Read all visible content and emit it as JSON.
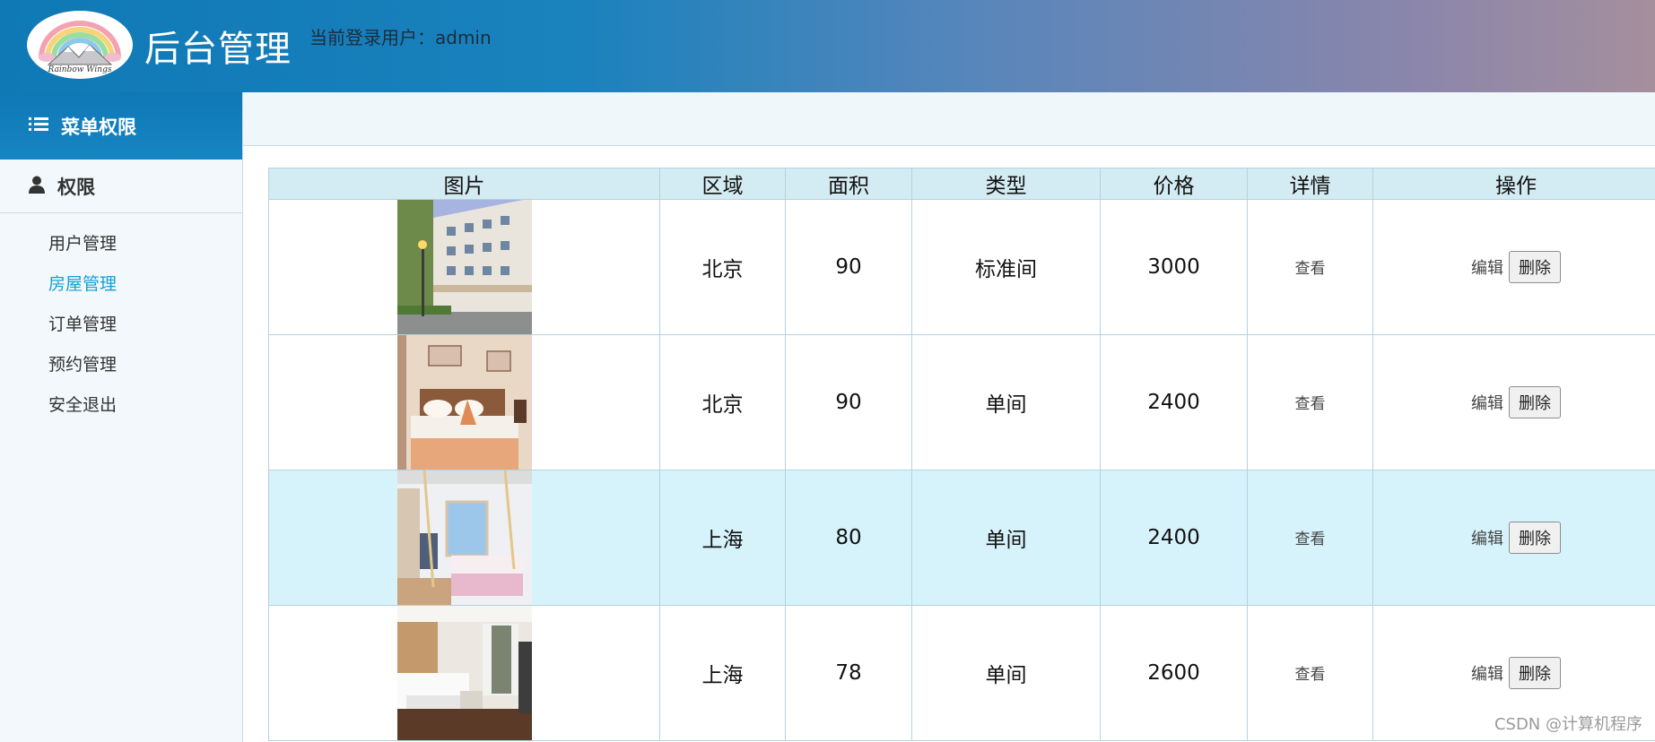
{
  "header": {
    "logo_text": "Rainbow Wings",
    "title": "后台管理",
    "login_label": "当前登录用户：admin"
  },
  "sidebar": {
    "menu_title": "菜单权限",
    "group_title": "权限",
    "items": [
      {
        "label": "用户管理"
      },
      {
        "label": "房屋管理"
      },
      {
        "label": "订单管理"
      },
      {
        "label": "预约管理"
      },
      {
        "label": "安全退出"
      }
    ],
    "active_index": 1,
    "active_color": "#14a0d6"
  },
  "table": {
    "columns": [
      "图片",
      "区域",
      "面积",
      "类型",
      "价格",
      "详情",
      "操作"
    ],
    "rows": [
      {
        "photo": "hotel-exterior",
        "region": "北京",
        "area": "90",
        "type": "标准间",
        "price": "3000",
        "detail": "查看",
        "edit": "编辑",
        "delete": "删除"
      },
      {
        "photo": "bedroom-warm",
        "region": "北京",
        "area": "90",
        "type": "单间",
        "price": "2400",
        "detail": "查看",
        "edit": "编辑",
        "delete": "删除"
      },
      {
        "photo": "bedroom-pink",
        "region": "上海",
        "area": "80",
        "type": "单间",
        "price": "2400",
        "detail": "查看",
        "edit": "编辑",
        "delete": "删除"
      },
      {
        "photo": "twin-room",
        "region": "上海",
        "area": "78",
        "type": "单间",
        "price": "2600",
        "detail": "查看",
        "edit": "编辑",
        "delete": "删除"
      }
    ],
    "highlight_row": 2
  },
  "watermark": "CSDN @计算机程序",
  "colors": {
    "header_start": "#0f79b6",
    "header_end": "#a58f9d",
    "th_bg": "#d3ebf2",
    "row_highlight": "#d6f2fb"
  }
}
